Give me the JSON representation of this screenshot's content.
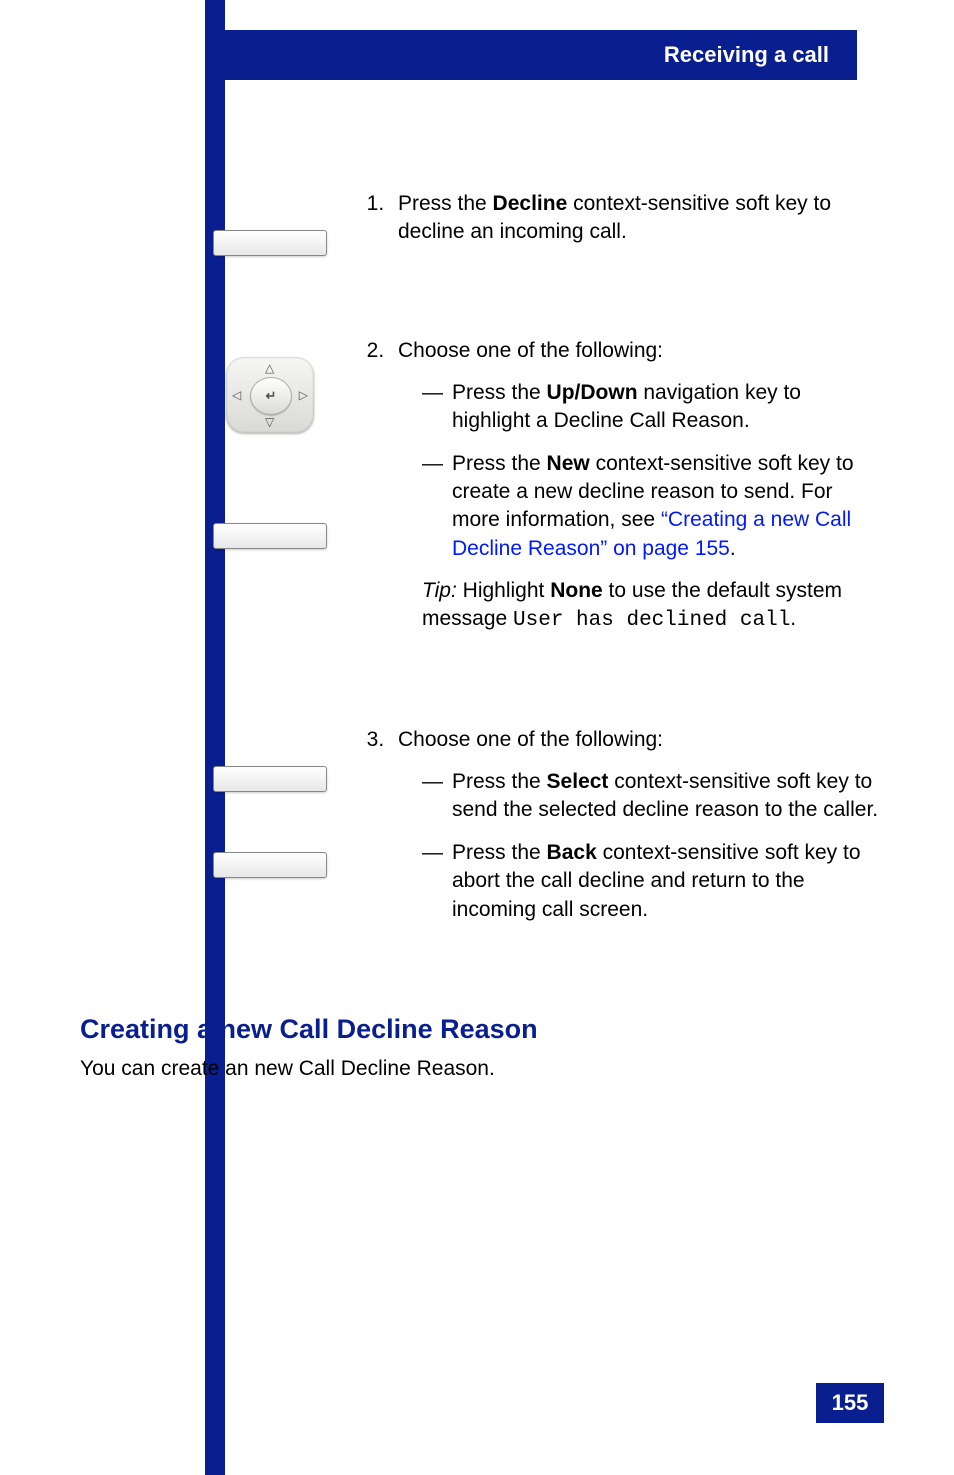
{
  "header": {
    "title": "Receiving a call"
  },
  "steps": {
    "s1": {
      "text_a": "Press the ",
      "label": "Decline",
      "text_b": " context-sensitive soft key to decline an incoming call."
    },
    "s2": {
      "intro": "Choose one of the following:",
      "opt1_a": "Press the ",
      "opt1_label": "Up/Down",
      "opt1_b": " navigation key to highlight a Decline Call Reason.",
      "opt2_a": "Press the ",
      "opt2_label": "New",
      "opt2_b": " context-sensitive soft key to create a new decline reason to send. For more information, see ",
      "opt2_link": "“Creating a new Call Decline Reason” on page 155",
      "opt2_c": ".",
      "tip_label": "Tip:",
      "tip_a": " Highlight ",
      "tip_bold": "None",
      "tip_b": " to use the default system message ",
      "tip_mono": "User has declined call",
      "tip_c": "."
    },
    "s3": {
      "intro": "Choose one of the following:",
      "opt1_a": "Press the ",
      "opt1_label": "Select",
      "opt1_b": " context-sensitive soft key to send the selected decline reason to the caller.",
      "opt2_a": "Press the ",
      "opt2_label": "Back",
      "opt2_b": " context-sensitive soft key to abort the call decline and return to the incoming call screen."
    }
  },
  "section": {
    "heading": "Creating a new Call Decline Reason",
    "body": "You can create an new Call Decline Reason."
  },
  "footer": {
    "page": "155"
  }
}
